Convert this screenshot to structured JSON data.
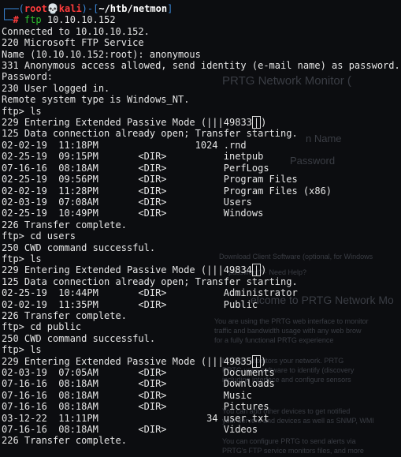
{
  "prompt": {
    "user": "root",
    "host": "kali",
    "cwd": "~/htb/netmon",
    "command_name": "ftp",
    "command_arg": "10.10.10.152"
  },
  "ghost": {
    "t1": "PRTG Network Monitor (",
    "t2": "n Name",
    "t3": "Password",
    "t4": "Download Client Software (optional, for Windows",
    "t5": "password? · Need Help?",
    "t6": "elcome to PRTG Network Mo",
    "t7": "You are using the PRTG web interface to monitor",
    "t8": "traffic and bandwidth usage with any web brow",
    "t9": "for a fully functional PRTG experience",
    "t10": "le \"LAN\" monitors your network. PRTG",
    "t11": "PRTG uses software to identify (discovery",
    "t12": "including interface and configure sensors",
    "t13": "You can add other devices to get notified",
    "t14": "your servers and devices as well as SNMP, WMI",
    "t15": "You can configure PRTG to send alerts via",
    "t16": "PRTG's FTP service monitors files, and more"
  },
  "lines": [
    "Connected to 10.10.10.152.",
    "220 Microsoft FTP Service",
    "Name (10.10.10.152:root): anonymous",
    "331 Anonymous access allowed, send identity (e-mail name) as password.",
    "Password:",
    "230 User logged in.",
    "Remote system type is Windows_NT.",
    "ftp> ls",
    "229 Entering Extended Passive Mode (|||49833|)",
    "125 Data connection already open; Transfer starting.",
    "02-02-19  11:18PM                 1024 .rnd",
    "02-25-19  09:15PM       <DIR>          inetpub",
    "07-16-16  08:18AM       <DIR>          PerfLogs",
    "02-25-19  09:56PM       <DIR>          Program Files",
    "02-02-19  11:28PM       <DIR>          Program Files (x86)",
    "02-03-19  07:08AM       <DIR>          Users",
    "02-25-19  10:49PM       <DIR>          Windows",
    "226 Transfer complete.",
    "ftp> cd users",
    "250 CWD command successful.",
    "ftp> ls",
    "229 Entering Extended Passive Mode (|||49834|)",
    "125 Data connection already open; Transfer starting.",
    "02-25-19  10:44PM       <DIR>          Administrator",
    "02-02-19  11:35PM       <DIR>          Public",
    "226 Transfer complete.",
    "ftp> cd public",
    "250 CWD command successful.",
    "ftp> ls",
    "229 Entering Extended Passive Mode (|||49835|)",
    "02-03-19  07:05AM       <DIR>          Documents",
    "07-16-16  08:18AM       <DIR>          Downloads",
    "07-16-16  08:18AM       <DIR>          Music",
    "07-16-16  08:18AM       <DIR>          Pictures",
    "03-12-22  11:11PM                   34 user.txt",
    "07-16-16  08:18AM       <DIR>          Videos",
    "226 Transfer complete."
  ]
}
